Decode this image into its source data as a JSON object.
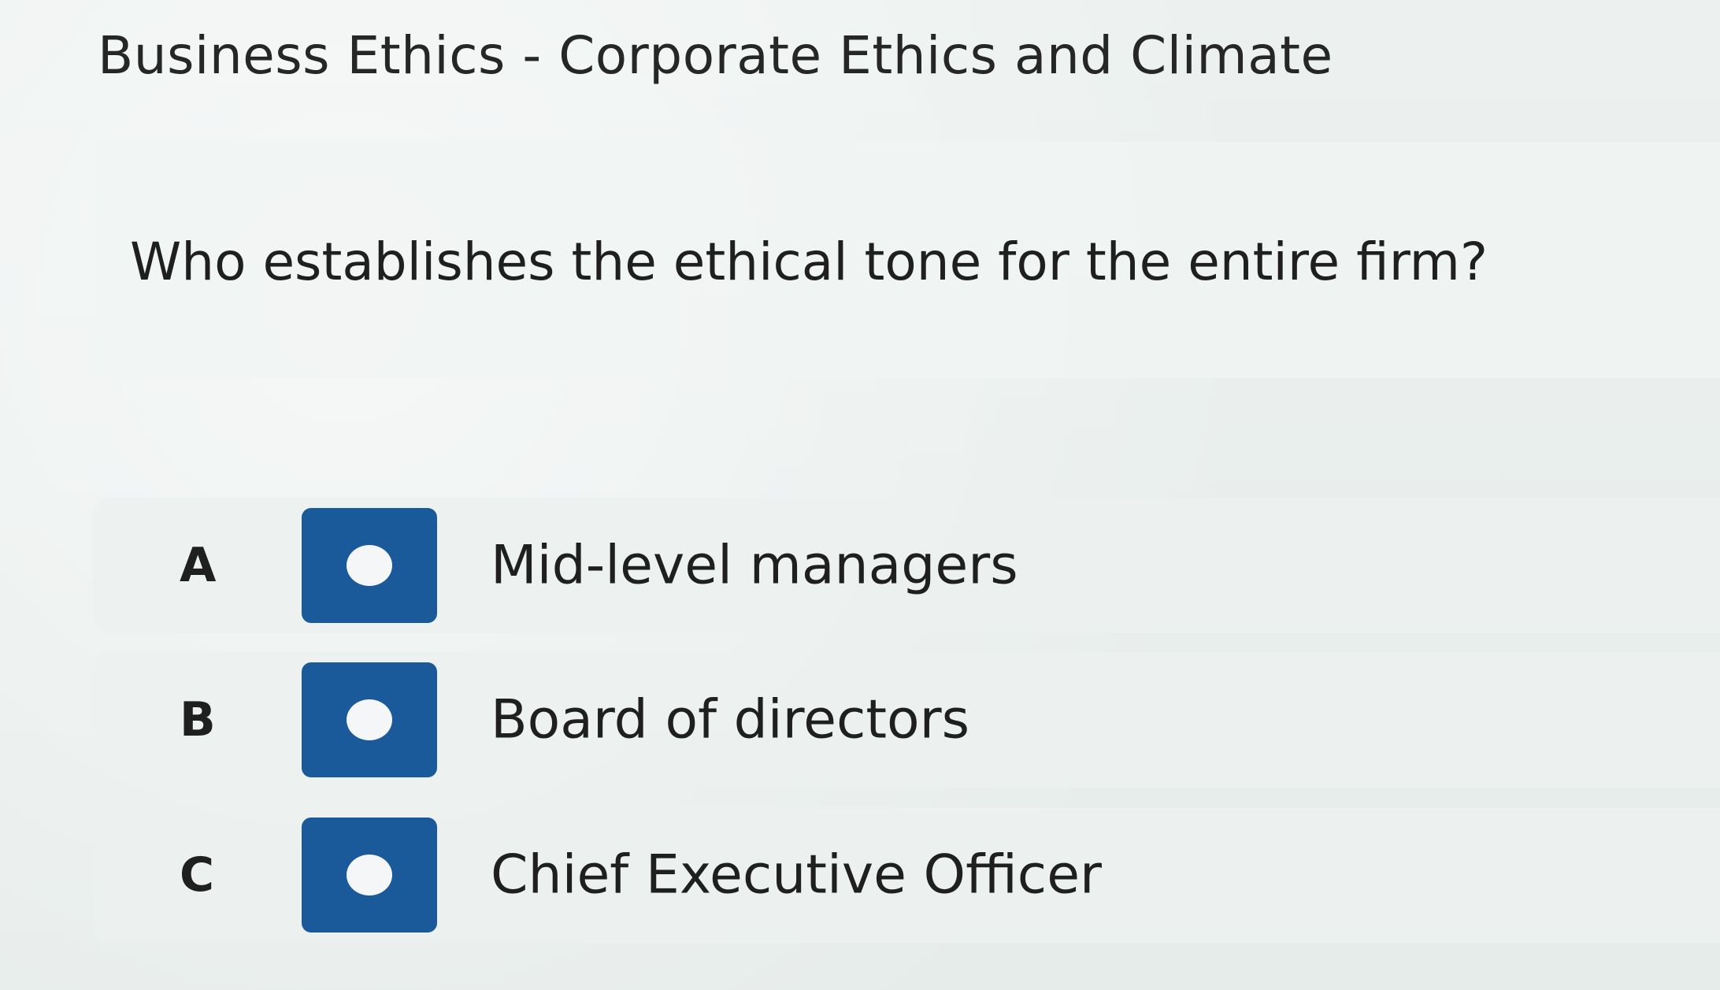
{
  "header": {
    "title": "Business Ethics - Corporate Ethics and Climate"
  },
  "question": {
    "text": "Who establishes the ethical tone for the entire firm?"
  },
  "options": [
    {
      "letter": "A",
      "label": "Mid-level managers"
    },
    {
      "letter": "B",
      "label": "Board of directors"
    },
    {
      "letter": "C",
      "label": "Chief Executive Officer"
    }
  ],
  "colors": {
    "radio_fill": "#1b5a9a",
    "radio_dot": "#f4f6f8",
    "text": "#1f1f1f"
  }
}
